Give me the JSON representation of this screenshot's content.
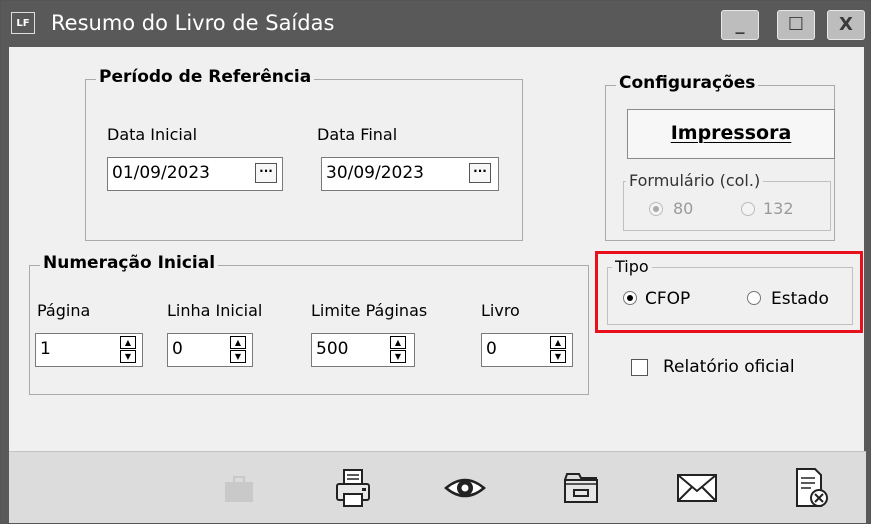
{
  "window": {
    "title": "Resumo do Livro de Saídas",
    "icon_text": "LF",
    "minimize_glyph": "_",
    "maximize_glyph": "☐",
    "close_glyph": "X"
  },
  "periodo": {
    "title": "Período de Referência",
    "data_inicial_label": "Data Inicial",
    "data_inicial_value": "01/09/2023",
    "data_final_label": "Data Final",
    "data_final_value": "30/09/2023",
    "dots": "···"
  },
  "numeracao": {
    "title": "Numeração Inicial",
    "pagina_label": "Página",
    "pagina_value": "1",
    "linha_label": "Linha Inicial",
    "linha_value": "0",
    "limite_label": "Limite Páginas",
    "limite_value": "500",
    "livro_label": "Livro",
    "livro_value": "0"
  },
  "configuracoes": {
    "title": "Configurações",
    "impressora_label": "Impressora",
    "formulario_title": "Formulário (col.)",
    "opt80": "80",
    "opt132": "132",
    "selected_cols": "80"
  },
  "tipo": {
    "title": "Tipo",
    "cfop_label": "CFOP",
    "estado_label": "Estado",
    "selected": "CFOP"
  },
  "relatorio": {
    "label": "Relatório oficial",
    "checked": false
  },
  "toolbar_icons": [
    "briefcase-icon",
    "printer-icon",
    "eye-icon",
    "folder-icon",
    "mail-icon",
    "document-close-icon"
  ],
  "colors": {
    "titlebar": "#595959",
    "highlight": "#e8101a",
    "window_bg": "#f0f0f0",
    "toolbar_bg": "#dcdcdc"
  }
}
